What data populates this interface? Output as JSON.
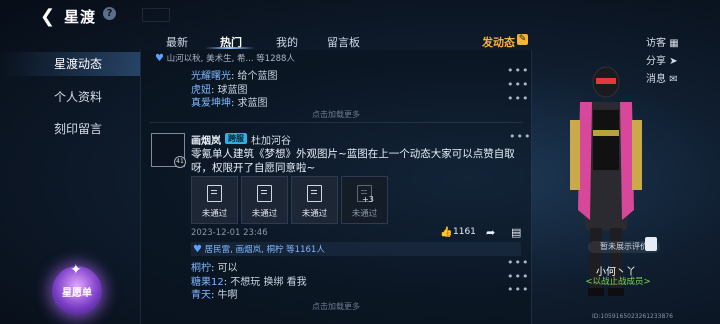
{
  "header": {
    "title": "星渡",
    "help": "?"
  },
  "nav": {
    "items": [
      {
        "label": "星渡动态",
        "active": true
      },
      {
        "label": "个人资料",
        "active": false
      },
      {
        "label": "刻印留言",
        "active": false
      }
    ],
    "star_list": "星愿单"
  },
  "tabs": [
    {
      "label": "最新",
      "active": false
    },
    {
      "label": "热门",
      "active": true
    },
    {
      "label": "我的",
      "active": false
    },
    {
      "label": "留言板",
      "active": false
    }
  ],
  "post_button": {
    "label": "发动态",
    "icon": "edit-icon"
  },
  "feed": {
    "prev_post": {
      "likes_line": "山河以秋, 美术生, 希... 等1288人",
      "comments": [
        {
          "name": "光耀曙光",
          "text": ": 给个蓝图"
        },
        {
          "name": "虎妞",
          "text": ": 球蓝图"
        },
        {
          "name": "真爱坤坤",
          "text": ": 求蓝图"
        }
      ],
      "load_more": "点击加载更多"
    },
    "post": {
      "level": "41",
      "author": "画烟岚",
      "server_badge": "跨服",
      "server": "杜加河谷",
      "body": "零氪单人建筑《梦想》外观图片~蓝图在上一个动态大家可以点赞自取呀，权限开了自愿同意啦~",
      "images": [
        {
          "label": "未通过"
        },
        {
          "label": "未通过"
        },
        {
          "label": "未通过"
        },
        {
          "label": "未通过",
          "more": "+3"
        }
      ],
      "timestamp": "2023-12-01 23:46",
      "like_count": "1161",
      "likes_line": "居民雷, 画烟岚, 桐柠 等1161人",
      "comments": [
        {
          "name": "桐柠",
          "text": ": 可以"
        },
        {
          "name": "糖果12",
          "text": ": 不想玩 换绑 看我"
        },
        {
          "name": "青天",
          "text": ": 牛啊"
        }
      ],
      "load_more": "点击加载更多"
    }
  },
  "right": {
    "visitors": "访客",
    "share": "分享",
    "messages": "消息",
    "eval": "暂未展示评价",
    "player_name": "小何丶丫",
    "player_tag": "<以战止战成员>",
    "uid": "ID:1059165023261233876"
  },
  "colors": {
    "accent": "#f6b23c",
    "link": "#7fb6ff",
    "badge": "#2bb2e8",
    "guild": "#7ed957"
  }
}
